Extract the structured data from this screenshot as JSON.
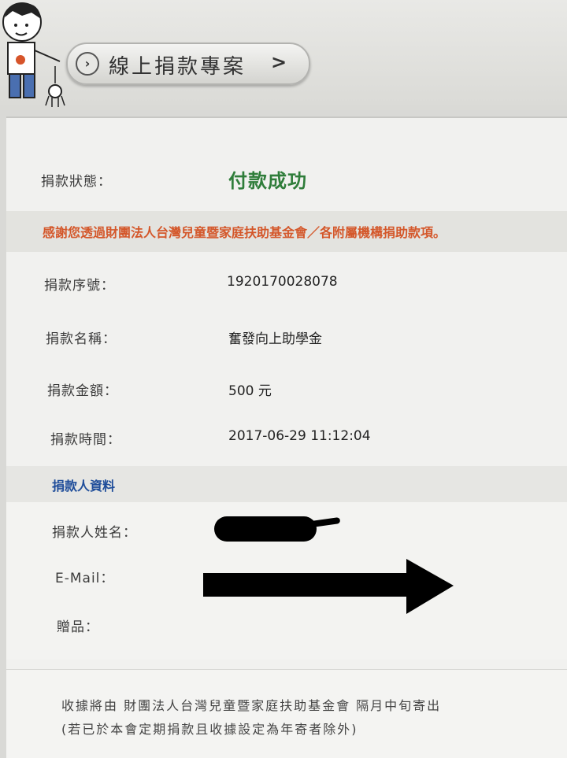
{
  "header": {
    "title": "線上捐款專案",
    "chevron": ">",
    "nav_arrow": "›"
  },
  "status": {
    "label": "捐款狀態：",
    "value": "付款成功",
    "color": "#2f7d3a"
  },
  "thanks_message": "感謝您透過財團法人台灣兒童暨家庭扶助基金會／各附屬機構捐助款項。",
  "donation": {
    "serial_label": "捐款序號：",
    "serial_value": "1920170028078",
    "name_label": "捐款名稱：",
    "name_value": "奮發向上助學金",
    "amount_label": "捐款金額：",
    "amount_value": "500 元",
    "time_label": "捐款時間：",
    "time_value": "2017-06-29 11:12:04"
  },
  "donor": {
    "section_title": "捐款人資料",
    "name_label": "捐款人姓名：",
    "email_label": "E-Mail：",
    "gift_label": "贈品："
  },
  "footer": {
    "line1": "收據將由 財團法人台灣兒童暨家庭扶助基金會 隔月中旬寄出",
    "line2": "(若已於本會定期捐款且收據設定為年寄者除外)"
  },
  "colors": {
    "accent_red": "#d4572a",
    "section_blue": "#1f4d9a"
  }
}
